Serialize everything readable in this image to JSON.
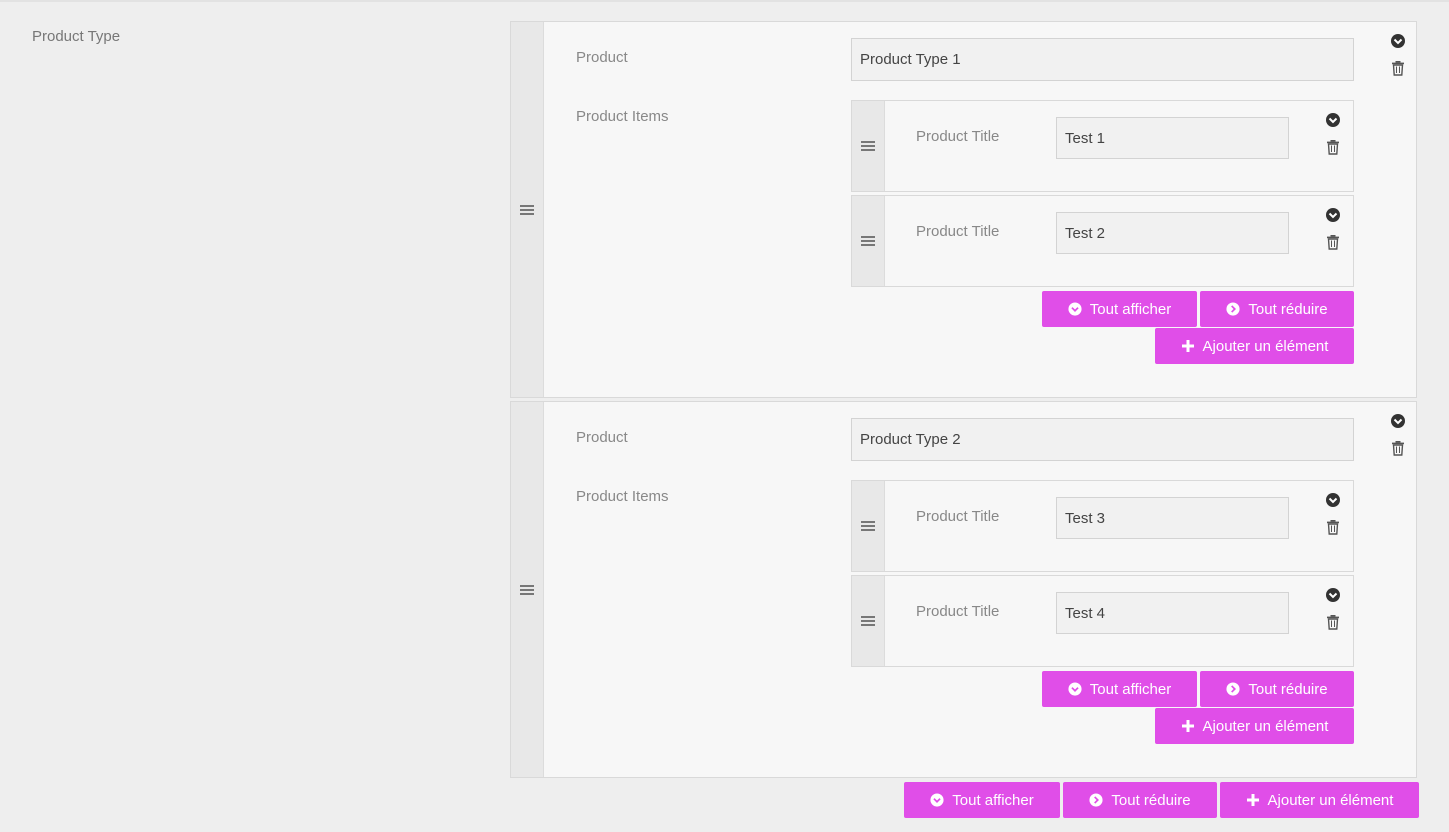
{
  "field": {
    "label": "Product Type"
  },
  "labels": {
    "product": "Product",
    "product_items": "Product Items",
    "product_title": "Product Title"
  },
  "buttons": {
    "expand_all": "Tout afficher",
    "collapse_all": "Tout réduire",
    "add_element": "Ajouter un élément"
  },
  "groups": [
    {
      "product_value": "Product Type 1",
      "items": [
        {
          "title_value": "Test 1"
        },
        {
          "title_value": "Test 2"
        }
      ]
    },
    {
      "product_value": "Product Type 2",
      "items": [
        {
          "title_value": "Test 3"
        },
        {
          "title_value": "Test 4"
        }
      ]
    }
  ],
  "icons": {
    "drag": "drag-handle-icon",
    "collapse": "chevron-circle-down-icon",
    "delete": "trash-icon",
    "expand": "chevron-circle-down-icon",
    "collapse_right": "chevron-circle-right-icon",
    "add": "plus-icon"
  },
  "colors": {
    "accent": "#e04ee8",
    "background": "#eeeeee",
    "panel": "#f7f7f7"
  }
}
